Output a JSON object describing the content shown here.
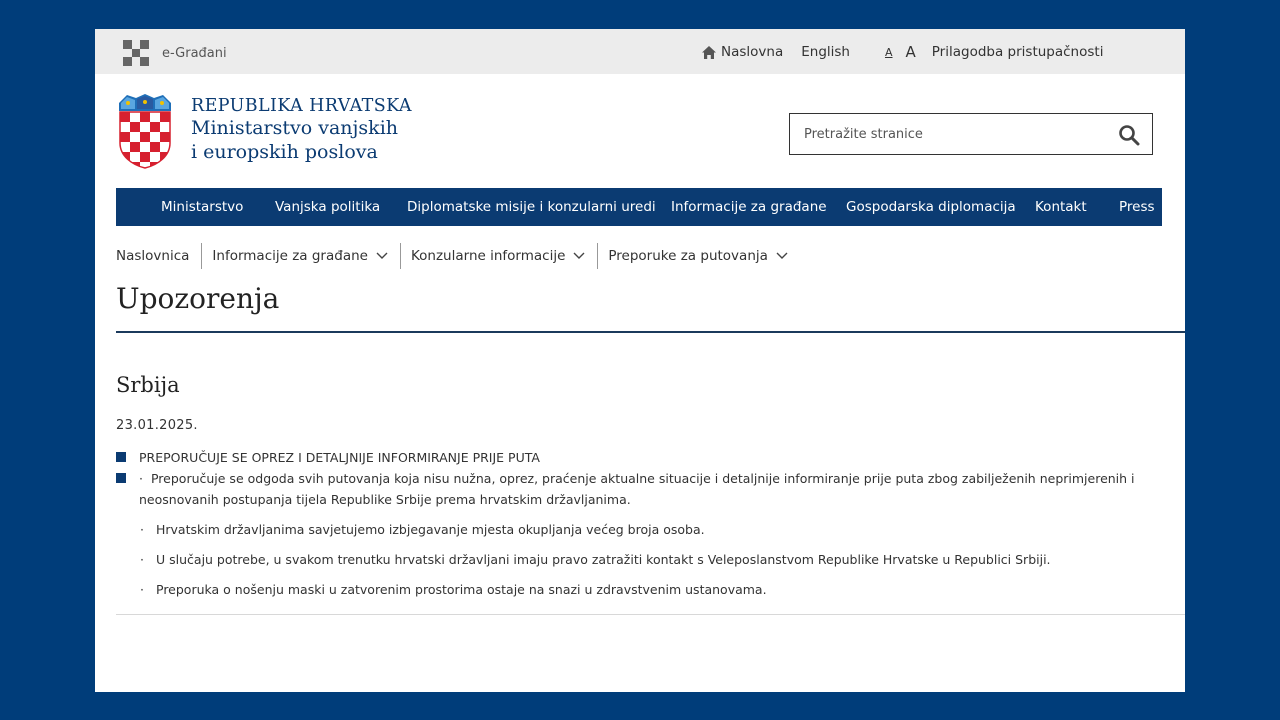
{
  "topbar": {
    "egradani_label": "e-Građani",
    "home_label": "Naslovna",
    "english_label": "English",
    "font_small": "A",
    "font_big": "A",
    "accessibility_label": "Prilagodba pristupačnosti"
  },
  "header": {
    "line1": "REPUBLIKA HRVATSKA",
    "line2": "Ministarstvo vanjskih",
    "line3": "i europskih poslova"
  },
  "search": {
    "placeholder": "Pretražite stranice"
  },
  "nav": {
    "items": [
      "Ministarstvo",
      "Vanjska politika",
      "Diplomatske misije i konzularni uredi",
      "Informacije za građane",
      "Gospodarska diplomacija",
      "Kontakt",
      "Press"
    ]
  },
  "breadcrumb": {
    "items": [
      "Naslovnica",
      "Informacije za građane",
      "Konzularne informacije",
      "Preporuke za putovanja"
    ]
  },
  "page": {
    "title": "Upozorenja",
    "section_title": "Srbija",
    "date": "23.01.2025."
  },
  "content": {
    "item1": "PREPORUČUJE SE OPREZ I DETALJNIJE INFORMIRANJE PRIJE PUTA",
    "item2": "Preporučuje se odgoda svih putovanja koja nisu nužna, oprez, praćenje aktualne situacije i detaljnije informiranje prije puta zbog zabilježenih neprimjerenih i neosnovanih postupanja tijela Republike Srbije prema hrvatskim državljanima.",
    "bullets": [
      "Hrvatskim državljanima savjetujemo izbjegavanje mjesta okupljanja većeg broja osoba.",
      "U slučaju potrebe, u svakom trenutku hrvatski državljani imaju pravo zatražiti kontakt s Veleposlanstvom Republike Hrvatske u Republici Srbiji.",
      "Preporuka o nošenju maski u zatvorenim prostorima ostaje na snazi u zdravstvenim ustanovama."
    ],
    "bullet_char": "·"
  },
  "colors": {
    "background": "#003d7a",
    "brand": "#0b3b72",
    "topbar": "#ececec"
  }
}
